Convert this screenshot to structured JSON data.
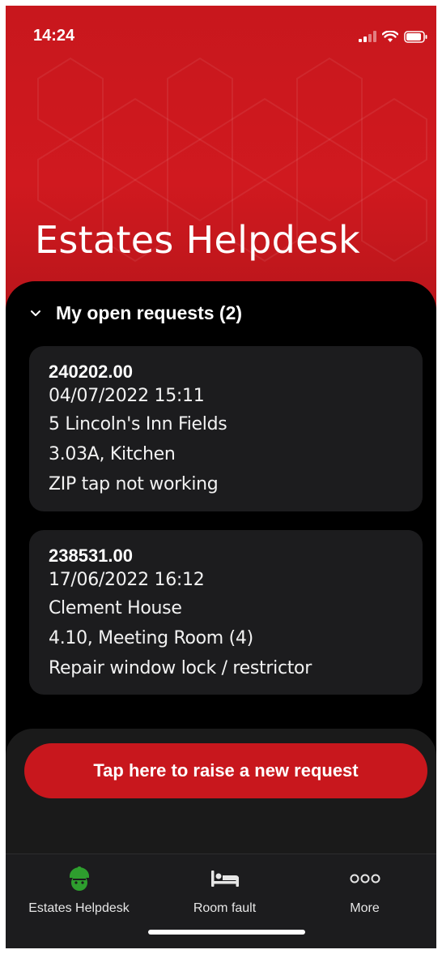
{
  "status_bar": {
    "time": "14:24"
  },
  "header": {
    "title": "Estates Helpdesk"
  },
  "requests_section": {
    "title": "My open requests (2)",
    "items": [
      {
        "id": "240202.00",
        "datetime": "04/07/2022 15:11",
        "building": "5 Lincoln's Inn Fields",
        "room": "3.03A, Kitchen",
        "description": "ZIP tap not working"
      },
      {
        "id": "238531.00",
        "datetime": "17/06/2022 16:12",
        "building": "Clement House",
        "room": "4.10, Meeting Room (4)",
        "description": "Repair window lock / restrictor"
      }
    ]
  },
  "cta": {
    "label": "Tap here to raise a new request"
  },
  "tabbar": {
    "tabs": [
      {
        "label": "Estates Helpdesk",
        "icon": "hard-hat-worker-icon",
        "active": true
      },
      {
        "label": "Room fault",
        "icon": "bed-icon",
        "active": false
      },
      {
        "label": "More",
        "icon": "more-dots-icon",
        "active": false
      }
    ]
  },
  "colors": {
    "brand_red": "#c8171d",
    "active_tab_green": "#2e9e2e",
    "card_bg": "#1c1c1e"
  }
}
